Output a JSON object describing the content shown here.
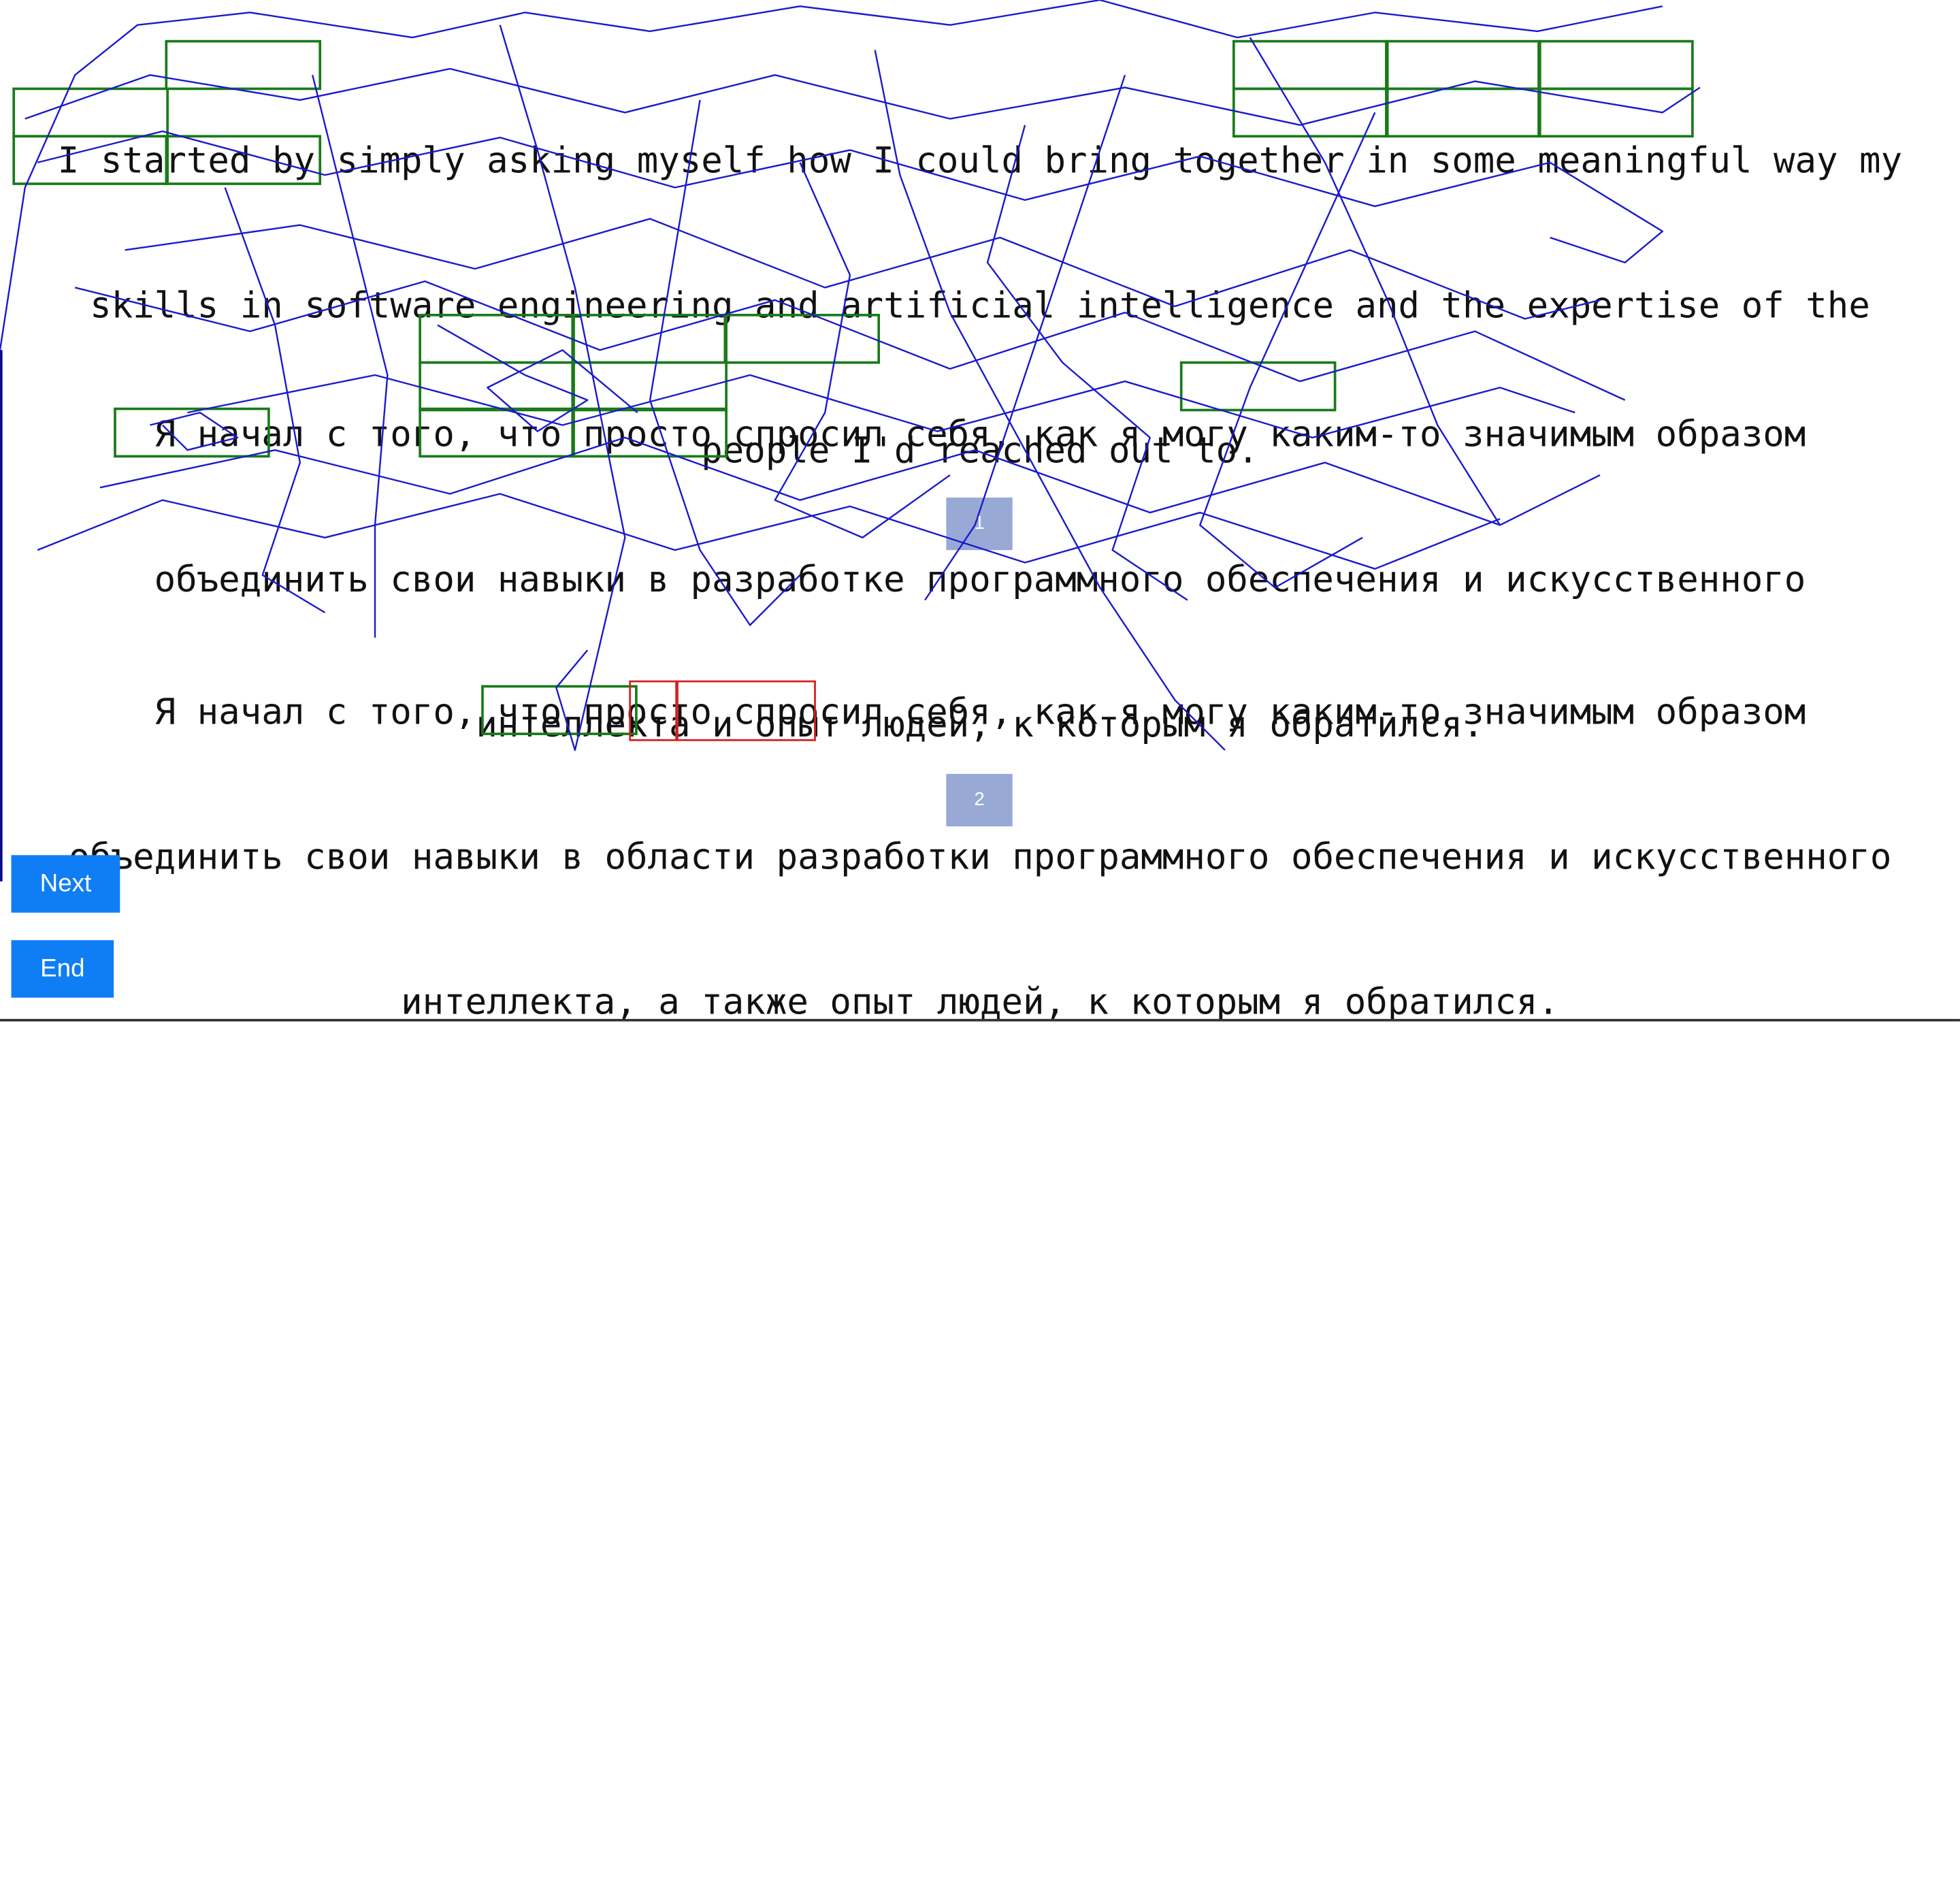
{
  "paragraphs": {
    "english": [
      "I started by simply asking myself how I could bring together in some meaningful way my",
      "skills in software engineering and artificial intelligence and the expertise of the",
      "people I'd reached out to."
    ],
    "russian_1": [
      "Я начал с того, что просто спросил себя, как я могу каким-то значимым образом",
      "объединить свои навыки в разработке программного обеспечения и искусственного",
      "интеллекта и опыт людей, к которым я обратился."
    ],
    "russian_2": [
      "Я начал с того, что просто спросил себя, как я могу каким-то значимым образом",
      "объединить свои навыки в области разработки программного обеспечения и искусственного",
      "интеллекта, а также опыт людей, к которым я обратился."
    ]
  },
  "badges": {
    "first": "1",
    "second": "2"
  },
  "buttons": {
    "next": "Next",
    "end": "End"
  },
  "colors": {
    "gaze_trace": "#1a1acc",
    "fixation_match": "#1a7a1a",
    "fixation_mismatch": "#d42020",
    "button": "#0f7ef5",
    "badge": "#98a9d6"
  }
}
